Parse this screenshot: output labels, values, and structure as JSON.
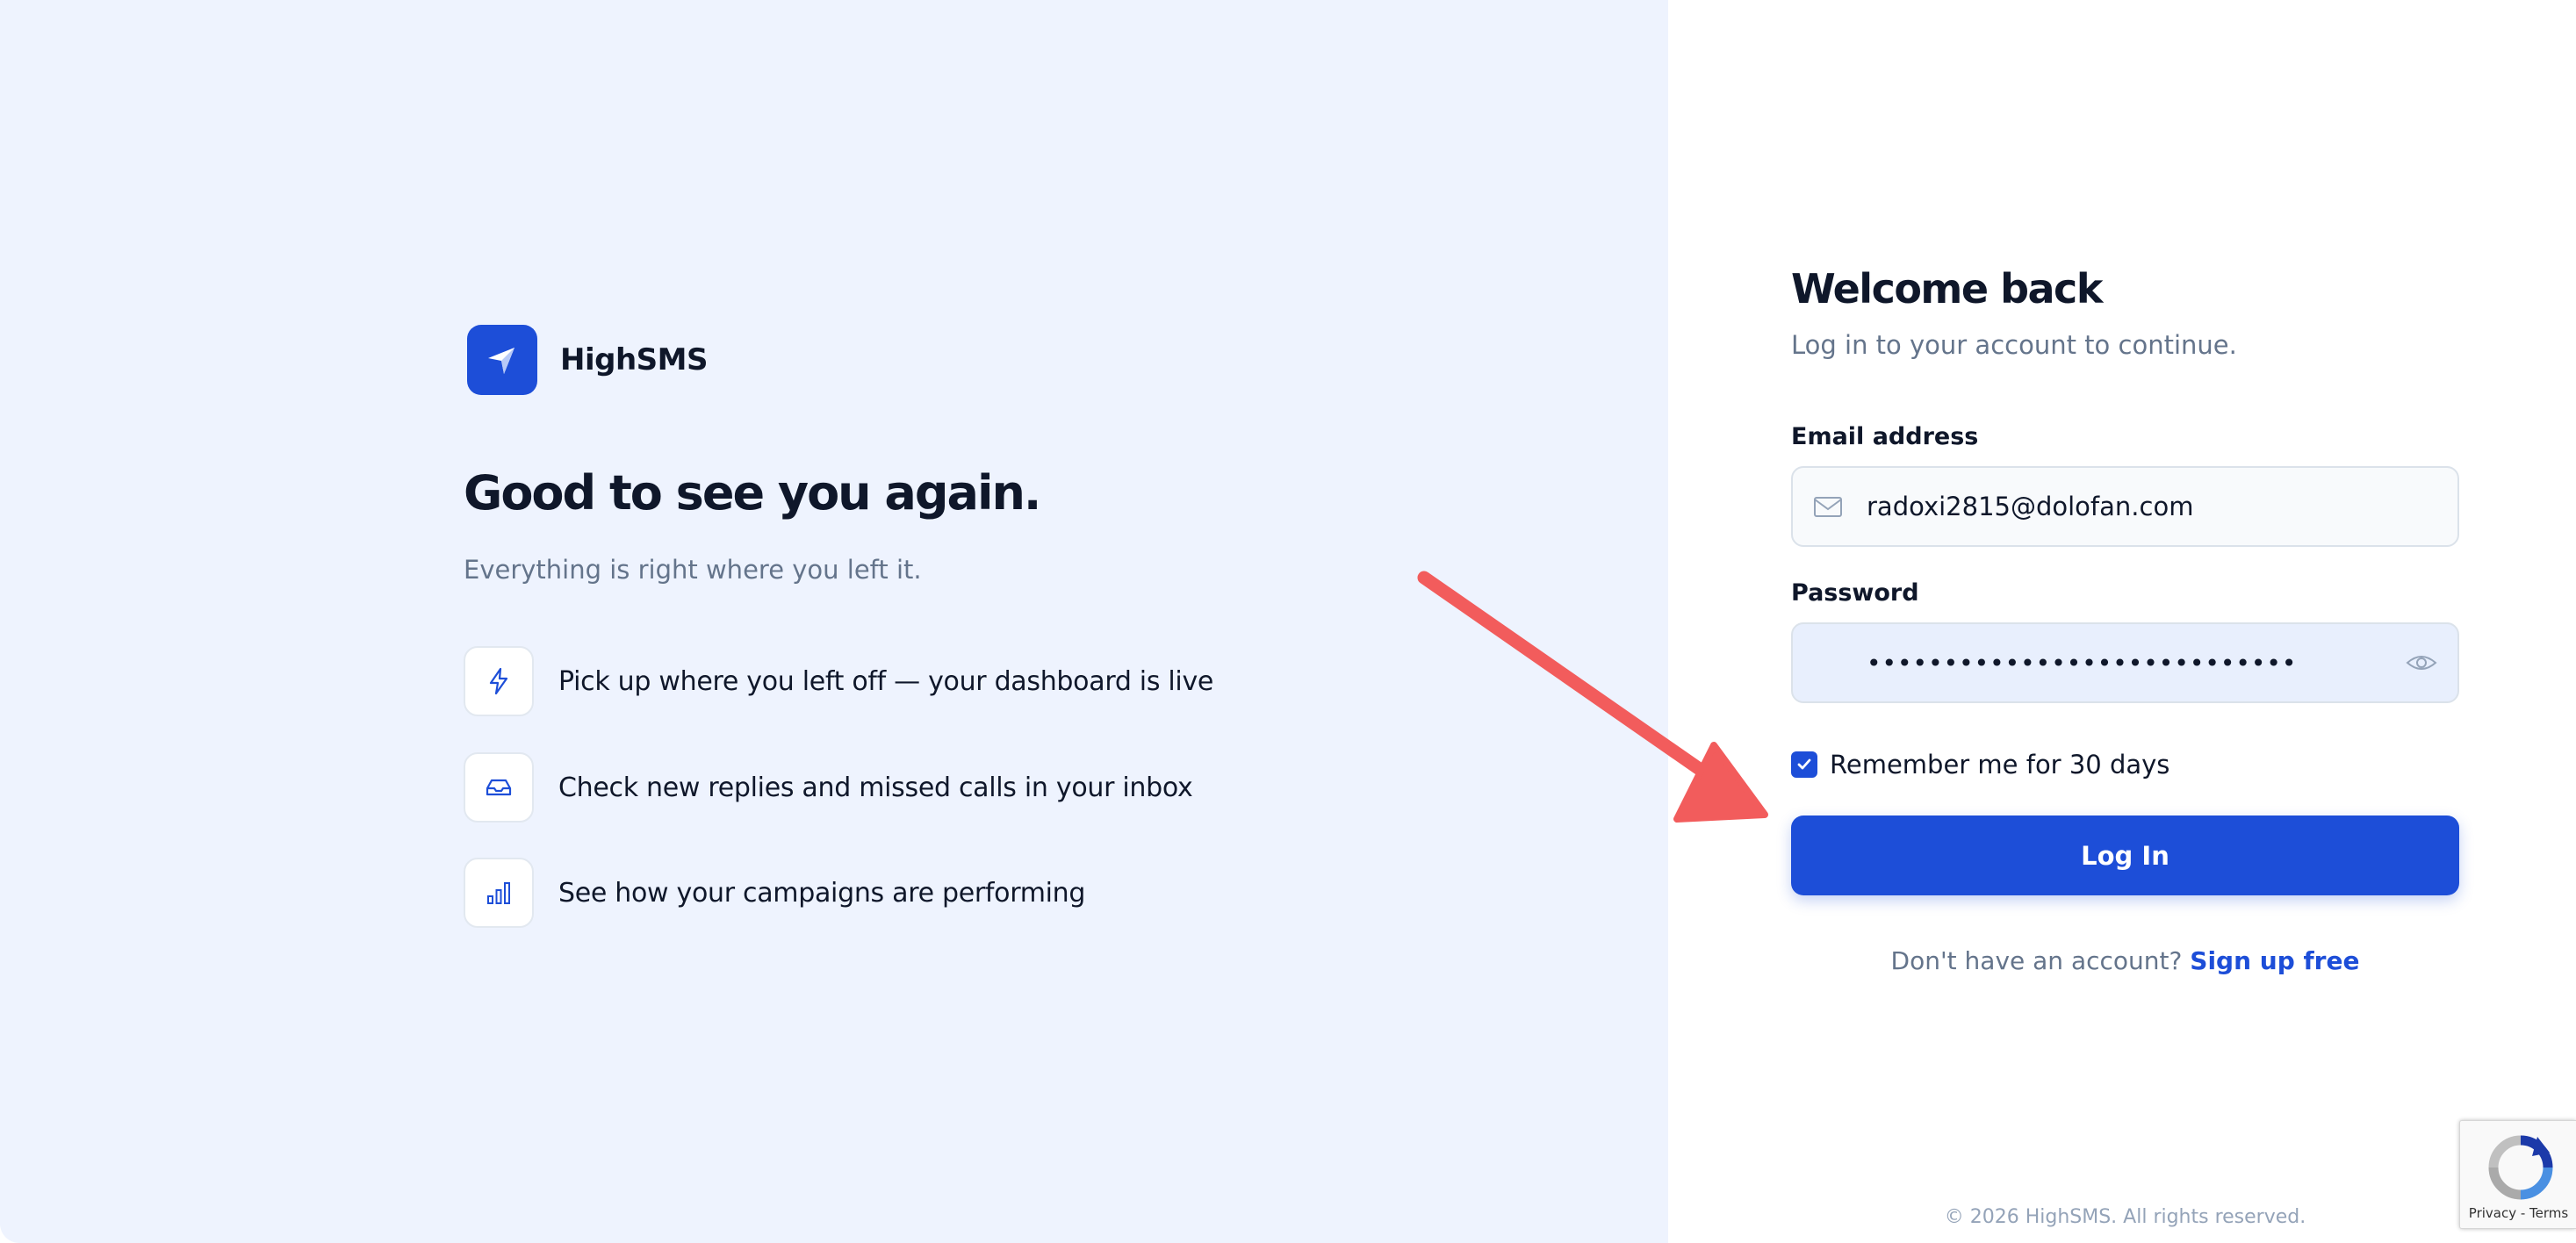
{
  "brand": {
    "name": "HighSMS",
    "icon": "paper-plane-icon"
  },
  "hero": {
    "headline": "Good to see you again.",
    "subline": "Everything is right where you left it."
  },
  "features": [
    {
      "icon": "lightning-bolt-icon",
      "text": "Pick up where you left off — your dashboard is live"
    },
    {
      "icon": "inbox-tray-icon",
      "text": "Check new replies and missed calls in your inbox"
    },
    {
      "icon": "bar-chart-icon",
      "text": "See how your campaigns are performing"
    }
  ],
  "login_form": {
    "title": "Welcome back",
    "subtitle": "Log in to your account to continue.",
    "email_label": "Email address",
    "email_value": "radoxi2815@dolofan.com",
    "password_label": "Password",
    "password_value": "••••••••••••••••••••••••••••",
    "remember_label": "Remember me for 30 days",
    "remember_checked": true,
    "submit_label": "Log In",
    "signup_prompt": "Don't have an account?",
    "signup_link": "Sign up free"
  },
  "footer": {
    "copyright": "© 2026 HighSMS. All rights reserved."
  },
  "recaptcha": {
    "links": "Privacy - Terms"
  },
  "colors": {
    "accent": "#1d4ed8",
    "left_background": "#eef3fe",
    "annotation_arrow": "#f25c5c"
  }
}
